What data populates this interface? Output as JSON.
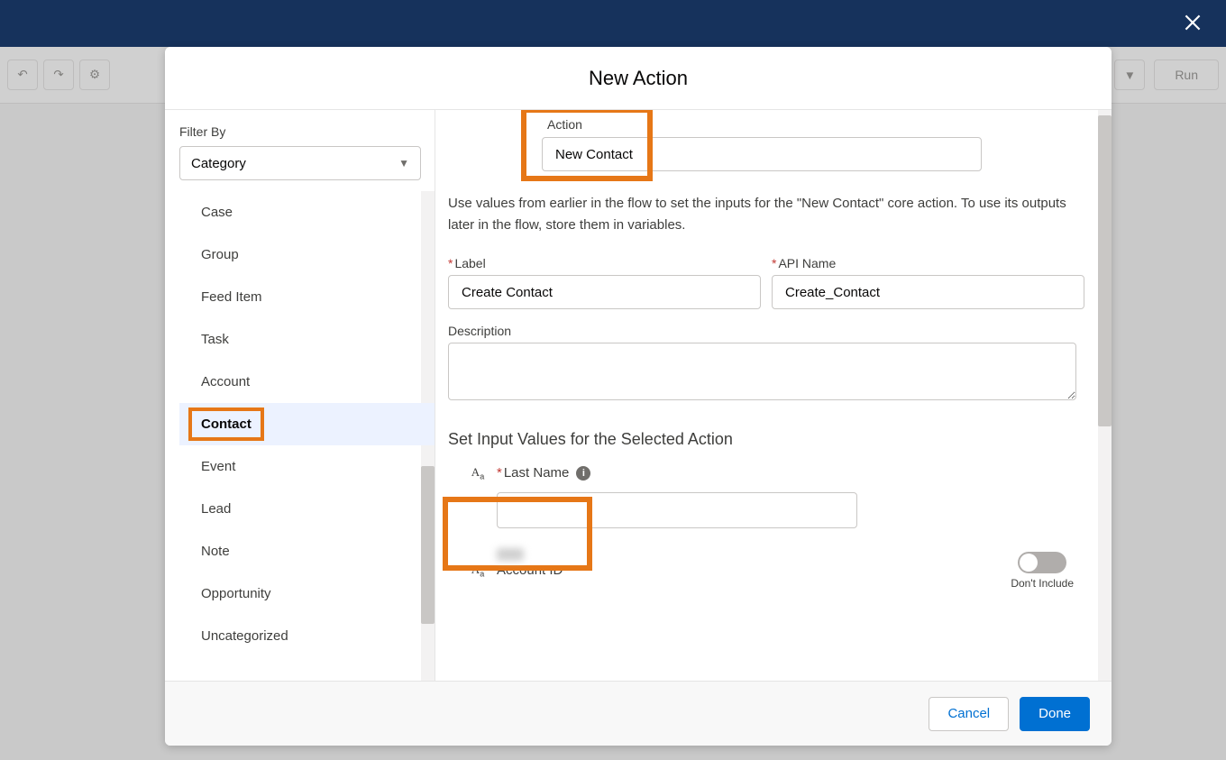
{
  "topbar": {
    "close_label": "Close"
  },
  "toolbar": {
    "undo": "↶",
    "redo": "↷",
    "settings": "⚙",
    "dropdown": "▼",
    "run_label": "Run"
  },
  "modal": {
    "title": "New Action",
    "filter_label": "Filter By",
    "filter_value": "Category",
    "categories": [
      "Case",
      "Group",
      "Feed Item",
      "Task",
      "Account",
      "Contact",
      "Event",
      "Lead",
      "Note",
      "Opportunity",
      "Uncategorized"
    ],
    "selected_category": "Contact",
    "action": {
      "label": "Action",
      "value": "New Contact"
    },
    "instruction": "Use values from earlier in the flow to set the inputs for the \"New Contact\" core action. To use its outputs later in the flow, store them in variables.",
    "fields": {
      "label_label": "Label",
      "label_value": "Create Contact",
      "api_label": "API Name",
      "api_value": "Create_Contact",
      "desc_label": "Description",
      "desc_value": ""
    },
    "input_section_title": "Set Input Values for the Selected Action",
    "inputs": {
      "last_name_label": "Last Name",
      "last_name_value": "",
      "account_id_label": "Account ID",
      "toggle_off_text": "Don't Include"
    },
    "footer": {
      "cancel": "Cancel",
      "done": "Done"
    }
  }
}
